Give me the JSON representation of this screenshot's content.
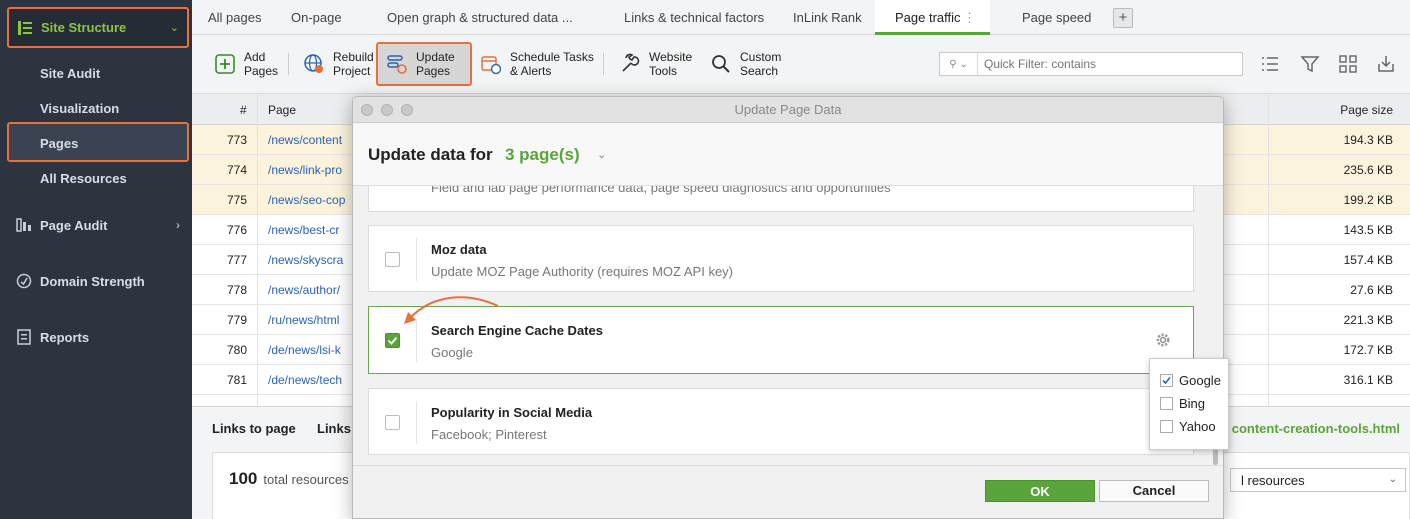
{
  "sidebar": {
    "header": "Site Structure",
    "sub_items": [
      "Site Audit",
      "Visualization",
      "Pages",
      "All Resources"
    ],
    "sections": [
      "Page Audit",
      "Domain Strength",
      "Reports"
    ]
  },
  "tabs": [
    "All pages",
    "On-page",
    "Open graph & structured data ...",
    "Links & technical factors",
    "InLink Rank",
    "Page traffic",
    "Page speed"
  ],
  "toolbar": {
    "add_pages": [
      "Add",
      "Pages"
    ],
    "rebuild_project": [
      "Rebuild",
      "Project"
    ],
    "update_pages": [
      "Update",
      "Pages"
    ],
    "schedule_tasks": [
      "Schedule Tasks",
      "& Alerts"
    ],
    "website_tools": [
      "Website",
      "Tools"
    ],
    "custom_search": [
      "Custom",
      "Search"
    ],
    "quick_filter_placeholder": "Quick Filter: contains"
  },
  "grid": {
    "headers": {
      "num": "#",
      "page": "Page",
      "size": "Page size"
    },
    "rows": [
      {
        "num": "773",
        "page": "/news/content",
        "size": "194.3 KB",
        "hl": true
      },
      {
        "num": "774",
        "page": "/news/link-pro",
        "size": "235.6 KB",
        "hl": true
      },
      {
        "num": "775",
        "page": "/news/seo-cop",
        "size": "199.2 KB",
        "hl": true
      },
      {
        "num": "776",
        "page": "/news/best-cr",
        "size": "143.5 KB",
        "hl": false
      },
      {
        "num": "777",
        "page": "/news/skyscra",
        "size": "157.4 KB",
        "hl": false
      },
      {
        "num": "778",
        "page": "/news/author/",
        "size": "27.6 KB",
        "hl": false
      },
      {
        "num": "779",
        "page": "/ru/news/html",
        "size": "221.3 KB",
        "hl": false
      },
      {
        "num": "780",
        "page": "/de/news/lsi-k",
        "size": "172.7 KB",
        "hl": false
      },
      {
        "num": "781",
        "page": "/de/news/tech",
        "size": "316.1 KB",
        "hl": false
      }
    ]
  },
  "bottom": {
    "tab1": "Links to page",
    "tab2": "Links",
    "link": "content-creation-tools.html",
    "count": "100",
    "count_label": "total resources",
    "select_value": "l resources"
  },
  "dialog": {
    "title": "Update Page Data",
    "heading": "Update data for",
    "count": "3 page(s)",
    "partial_desc": "Field and lab page performance data, page speed diagnostics and opportunities",
    "cards": [
      {
        "title": "Moz data",
        "desc": "Update MOZ Page Authority (requires MOZ API key)",
        "checked": false
      },
      {
        "title": "Search Engine Cache Dates",
        "desc": "Google",
        "checked": true
      },
      {
        "title": "Popularity in Social Media",
        "desc": "Facebook; Pinterest",
        "checked": false
      }
    ],
    "ok": "OK",
    "cancel": "Cancel"
  },
  "popup": {
    "items": [
      {
        "label": "Google",
        "checked": true
      },
      {
        "label": "Bing",
        "checked": false
      },
      {
        "label": "Yahoo",
        "checked": false
      }
    ]
  },
  "colors": {
    "accent": "#5aa53a",
    "highlight": "#e8703a",
    "sidebar": "#2d3440",
    "link": "#2a62b5"
  }
}
